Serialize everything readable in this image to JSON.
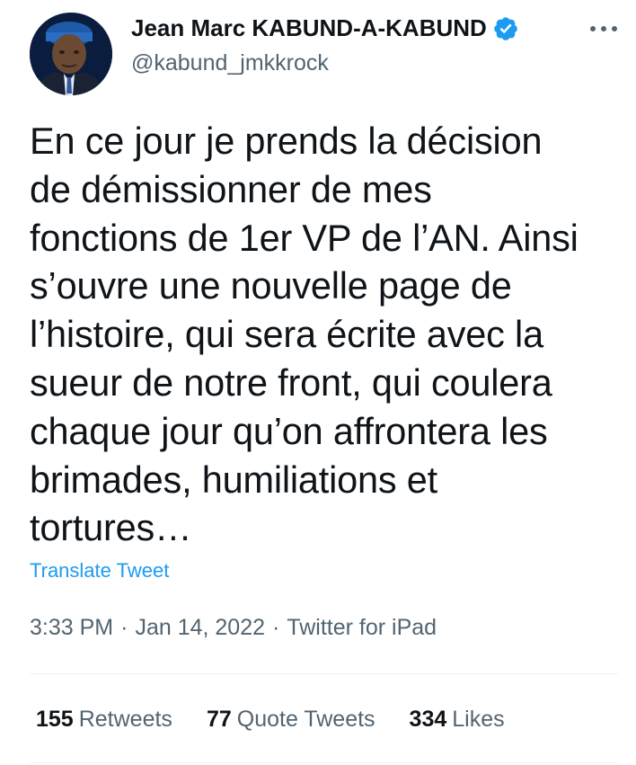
{
  "author": {
    "display_name": "Jean Marc KABUND-A-KABUND",
    "handle": "@kabund_jmkkrock",
    "verified_icon": "verified-badge-icon",
    "avatar_icon": "profile-photo"
  },
  "tweet": {
    "text": "En ce jour je prends la décision\nde démissionner de mes\nfonctions de 1er VP de l’AN. Ainsi\ns’ouvre une nouvelle page de\nl’histoire, qui sera écrite avec la\nsueur de notre front, qui coulera\nchaque jour qu’on affrontera les\nbrimades, humiliations et\ntortures…",
    "translate_label": "Translate Tweet",
    "time": "3:33 PM",
    "date": "Jan 14, 2022",
    "source": "Twitter for iPad",
    "separator": "·"
  },
  "stats": {
    "retweets_count": "155",
    "retweets_label": "Retweets",
    "quotes_count": "77",
    "quotes_label": "Quote Tweets",
    "likes_count": "334",
    "likes_label": "Likes"
  },
  "colors": {
    "link": "#1d9bf0",
    "secondary_text": "#536471",
    "primary_text": "#0f1419",
    "divider": "#eff3f4"
  }
}
